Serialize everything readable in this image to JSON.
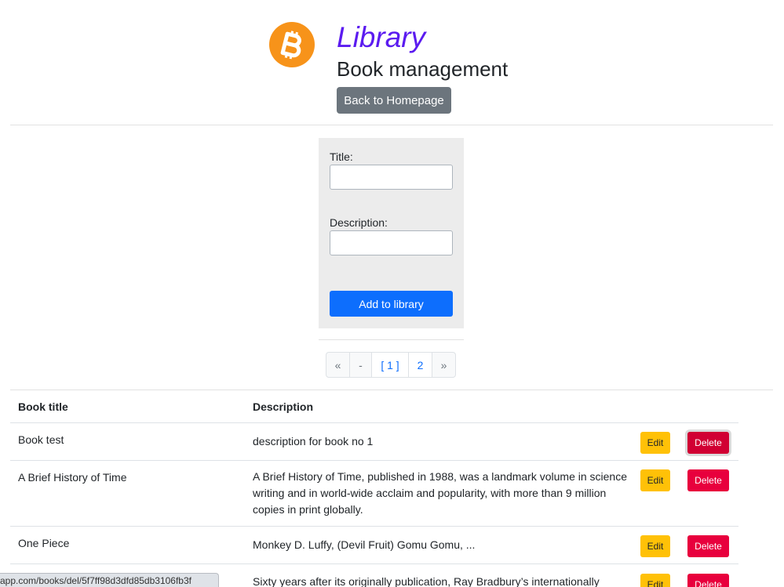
{
  "header": {
    "logo_icon": "bitcoin-icon",
    "logo_color": "#f7931a",
    "title": "Library",
    "subtitle": "Book management",
    "back_button": "Back to Homepage"
  },
  "form": {
    "title_label": "Title:",
    "title_value": "",
    "description_label": "Description:",
    "description_value": "",
    "submit_button": "Add to library"
  },
  "pagination": {
    "items": [
      "«",
      "-",
      "[ 1 ]",
      "2",
      "»"
    ],
    "current": "1"
  },
  "table": {
    "headers": {
      "title": "Book title",
      "description": "Description"
    },
    "edit_label": "Edit",
    "delete_label": "Delete",
    "rows": [
      {
        "title": "Book test",
        "description": "description for book no 1"
      },
      {
        "title": "A Brief History of Time",
        "description": "A Brief History of Time, published in 1988, was a landmark volume in science writing and in world-wide acclaim and popularity, with more than 9 million copies in print globally."
      },
      {
        "title": "One Piece",
        "description": "Monkey D. Luffy, (Devil Fruit) Gomu Gomu, ..."
      },
      {
        "title": "",
        "description": "Sixty years after its originally publication, Ray Bradbury’s internationally"
      }
    ]
  },
  "status_bar": {
    "url": "app.com/books/del/5f7ff98d3dfd85db3106fb3f"
  },
  "colors": {
    "title": "#5b1bf0",
    "primary": "#0d6efd",
    "secondary": "#6c757d",
    "warning": "#ffc107",
    "danger": "#e8003d"
  }
}
